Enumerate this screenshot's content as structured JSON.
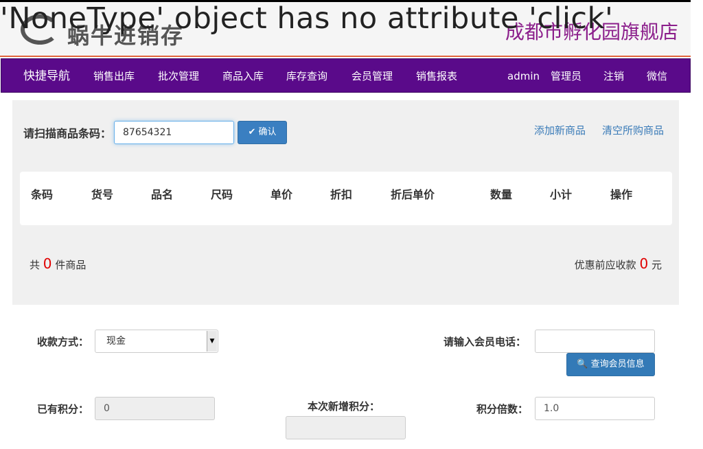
{
  "error": "'NoneType' object has no attribute 'click'",
  "header": {
    "logo_text": "蜗牛进销存",
    "store_name": "成都市孵化园旗舰店"
  },
  "nav": {
    "brand": "快捷导航",
    "items": [
      "销售出库",
      "批次管理",
      "商品入库",
      "库存查询",
      "会员管理",
      "销售报表"
    ],
    "user": "admin",
    "role": "管理员",
    "logout": "注销",
    "wechat": "微信"
  },
  "scan": {
    "label": "请扫描商品条码：",
    "value": "87654321",
    "confirm_label": "确认",
    "add_link": "添加新商品",
    "clear_link": "清空所购商品"
  },
  "table": {
    "headers": [
      "条码",
      "货号",
      "品名",
      "尺码",
      "单价",
      "折扣",
      "折后单价",
      "数量",
      "小计",
      "操作"
    ]
  },
  "summary": {
    "count_prefix": "共",
    "count": "0",
    "count_suffix": "件商品",
    "total_prefix": "优惠前应收款",
    "total": "0",
    "total_suffix": "元"
  },
  "payment": {
    "label": "收款方式：",
    "selected": "现金"
  },
  "member": {
    "phone_label": "请输入会员电话：",
    "phone_value": "",
    "query_label": "查询会员信息"
  },
  "points": {
    "existing_label": "已有积分：",
    "existing_value": "0",
    "new_label": "本次新增积分：",
    "new_value": "",
    "multiplier_label": "积分倍数：",
    "multiplier_value": "1.0"
  },
  "colors": {
    "nav_bg": "#5a0a8a",
    "store_name": "#8b1e8b",
    "primary_button": "#337ab7",
    "highlight_number": "#e00000",
    "link": "#3a7bb8"
  }
}
